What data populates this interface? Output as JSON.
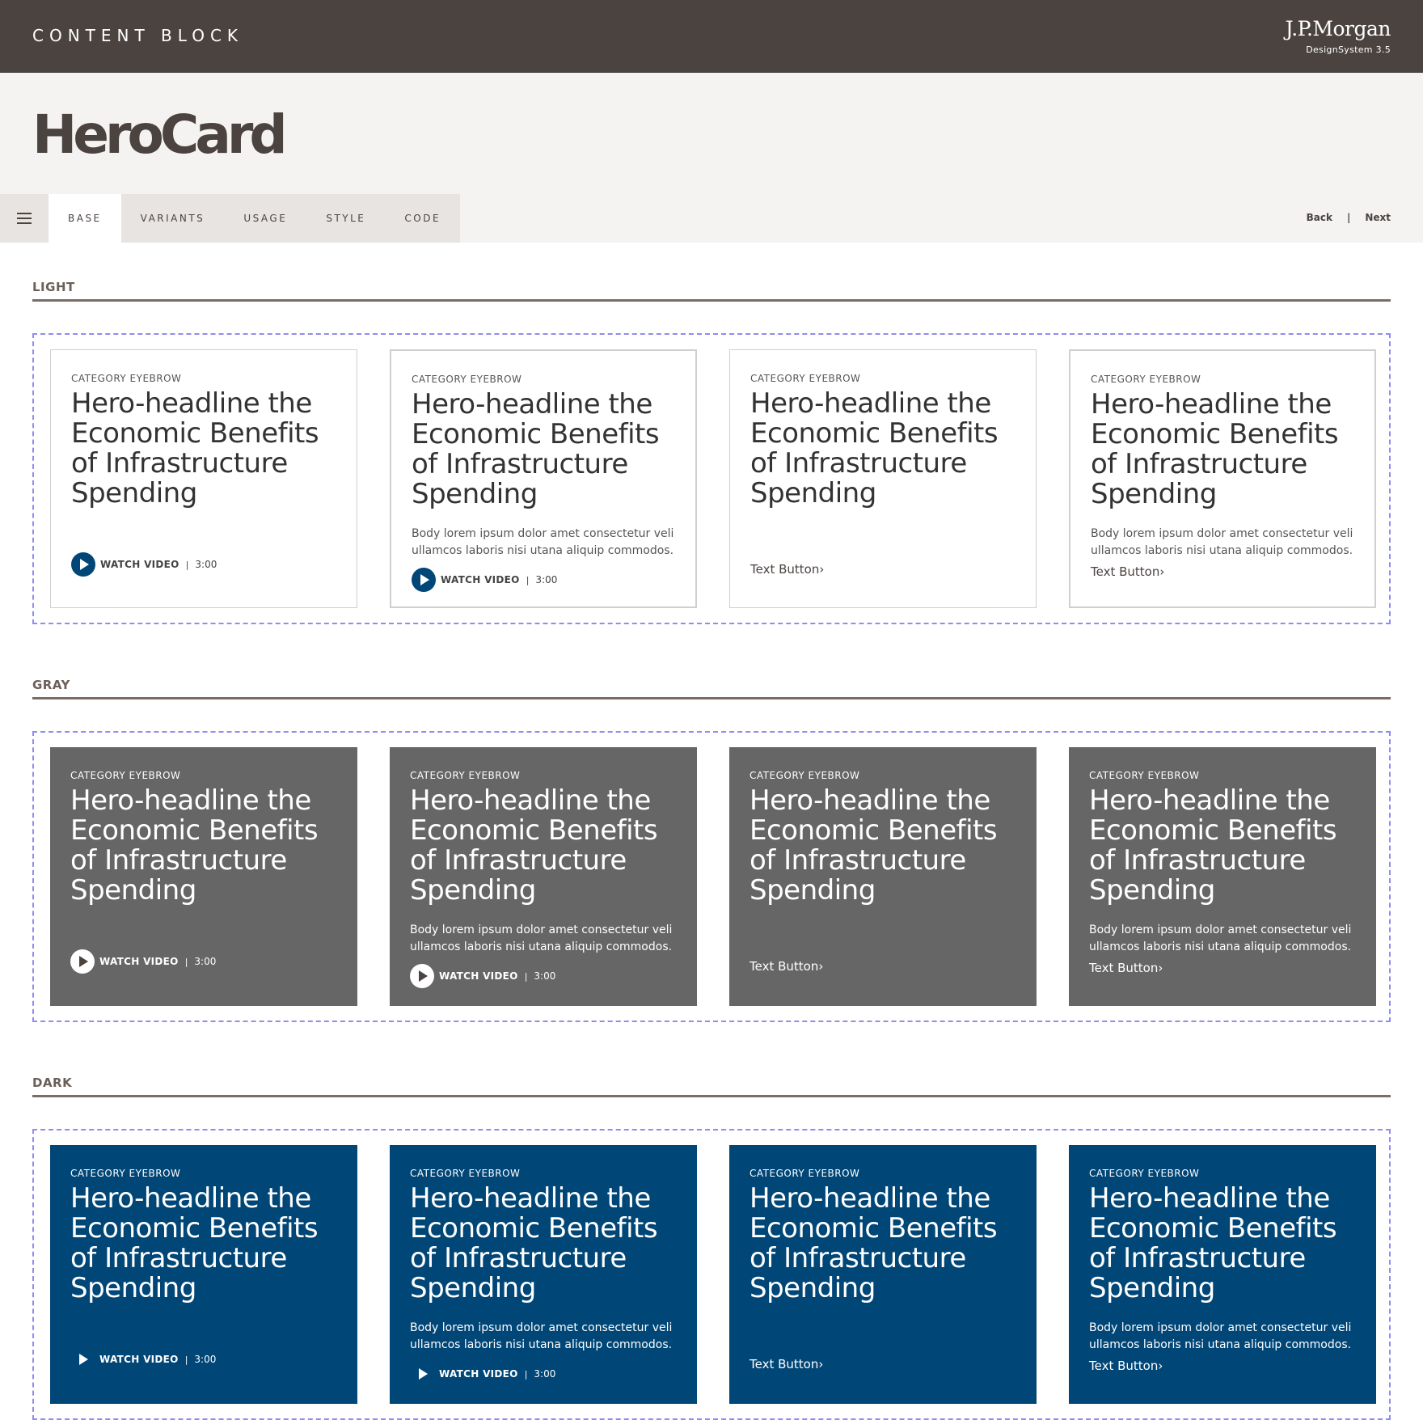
{
  "topbar": {
    "section_label": "CONTENT BLOCK",
    "brand_name": "J.P.Morgan",
    "brand_sub": "DesignSystem  3.5"
  },
  "page": {
    "title": "HeroCard"
  },
  "tabs": [
    "BASE",
    "VARIANTS",
    "USAGE",
    "STYLE",
    "CODE"
  ],
  "active_tab": "BASE",
  "pager": {
    "back": "Back",
    "divider": "|",
    "next": "Next"
  },
  "card": {
    "eyebrow": "CATEGORY EYEBROW",
    "headline": "Hero-headline the Economic Benefits of Infrastructure Spending",
    "body": "Body lorem ipsum dolor amet consectetur veli ullamcos laboris nisi utana aliquip commodos.",
    "watch_label": "WATCH VIDEO",
    "divider": "|",
    "duration": "3:00",
    "text_button": "Text Button",
    "chevron": "›"
  },
  "sections": [
    {
      "label": "LIGHT"
    },
    {
      "label": "GRAY"
    },
    {
      "label": "DARK"
    }
  ],
  "colors": {
    "brand_dark": "#4b4340",
    "gray_card": "#666666",
    "dark_card": "#004677",
    "dash_border": "#8f8cf0"
  },
  "icons": {
    "menu": "hamburger-icon",
    "play": "play-icon",
    "chevron": "chevron-right-icon"
  }
}
